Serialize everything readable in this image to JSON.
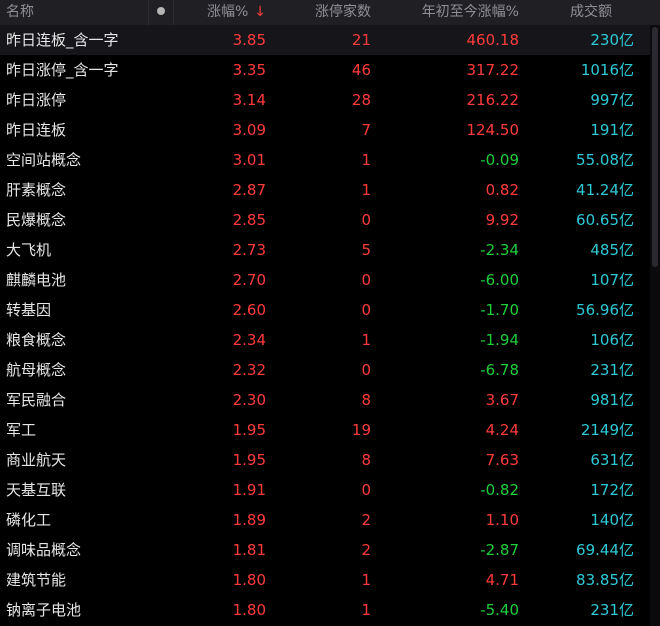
{
  "header": {
    "name": "名称",
    "change_pct": "涨幅%",
    "change_pct_arrow": "↓",
    "limit_up_count": "涨停家数",
    "ytd_change": "年初至今涨幅%",
    "turnover": "成交额"
  },
  "colors": {
    "up": "#ff3b3b",
    "down": "#1fce3b",
    "turnover": "#2fc9d6",
    "header_bg": "#1f1f24",
    "bg": "#000000"
  },
  "rows": [
    {
      "name": "昨日连板_含一字",
      "pct": "3.85",
      "cnt": "21",
      "ytd": "460.18",
      "ytd_dir": "up",
      "vol": "230亿"
    },
    {
      "name": "昨日涨停_含一字",
      "pct": "3.35",
      "cnt": "46",
      "ytd": "317.22",
      "ytd_dir": "up",
      "vol": "1016亿"
    },
    {
      "name": "昨日涨停",
      "pct": "3.14",
      "cnt": "28",
      "ytd": "216.22",
      "ytd_dir": "up",
      "vol": "997亿"
    },
    {
      "name": "昨日连板",
      "pct": "3.09",
      "cnt": "7",
      "ytd": "124.50",
      "ytd_dir": "up",
      "vol": "191亿"
    },
    {
      "name": "空间站概念",
      "pct": "3.01",
      "cnt": "1",
      "ytd": "-0.09",
      "ytd_dir": "down",
      "vol": "55.08亿"
    },
    {
      "name": "肝素概念",
      "pct": "2.87",
      "cnt": "1",
      "ytd": "0.82",
      "ytd_dir": "up",
      "vol": "41.24亿"
    },
    {
      "name": "民爆概念",
      "pct": "2.85",
      "cnt": "0",
      "ytd": "9.92",
      "ytd_dir": "up",
      "vol": "60.65亿"
    },
    {
      "name": "大飞机",
      "pct": "2.73",
      "cnt": "5",
      "ytd": "-2.34",
      "ytd_dir": "down",
      "vol": "485亿"
    },
    {
      "name": "麒麟电池",
      "pct": "2.70",
      "cnt": "0",
      "ytd": "-6.00",
      "ytd_dir": "down",
      "vol": "107亿"
    },
    {
      "name": "转基因",
      "pct": "2.60",
      "cnt": "0",
      "ytd": "-1.70",
      "ytd_dir": "down",
      "vol": "56.96亿"
    },
    {
      "name": "粮食概念",
      "pct": "2.34",
      "cnt": "1",
      "ytd": "-1.94",
      "ytd_dir": "down",
      "vol": "106亿"
    },
    {
      "name": "航母概念",
      "pct": "2.32",
      "cnt": "0",
      "ytd": "-6.78",
      "ytd_dir": "down",
      "vol": "231亿"
    },
    {
      "name": "军民融合",
      "pct": "2.30",
      "cnt": "8",
      "ytd": "3.67",
      "ytd_dir": "up",
      "vol": "981亿"
    },
    {
      "name": "军工",
      "pct": "1.95",
      "cnt": "19",
      "ytd": "4.24",
      "ytd_dir": "up",
      "vol": "2149亿"
    },
    {
      "name": "商业航天",
      "pct": "1.95",
      "cnt": "8",
      "ytd": "7.63",
      "ytd_dir": "up",
      "vol": "631亿"
    },
    {
      "name": "天基互联",
      "pct": "1.91",
      "cnt": "0",
      "ytd": "-0.82",
      "ytd_dir": "down",
      "vol": "172亿"
    },
    {
      "name": "磷化工",
      "pct": "1.89",
      "cnt": "2",
      "ytd": "1.10",
      "ytd_dir": "up",
      "vol": "140亿"
    },
    {
      "name": "调味品概念",
      "pct": "1.81",
      "cnt": "2",
      "ytd": "-2.87",
      "ytd_dir": "down",
      "vol": "69.44亿"
    },
    {
      "name": "建筑节能",
      "pct": "1.80",
      "cnt": "1",
      "ytd": "4.71",
      "ytd_dir": "up",
      "vol": "83.85亿"
    },
    {
      "name": "钠离子电池",
      "pct": "1.80",
      "cnt": "1",
      "ytd": "-5.40",
      "ytd_dir": "down",
      "vol": "231亿"
    }
  ]
}
